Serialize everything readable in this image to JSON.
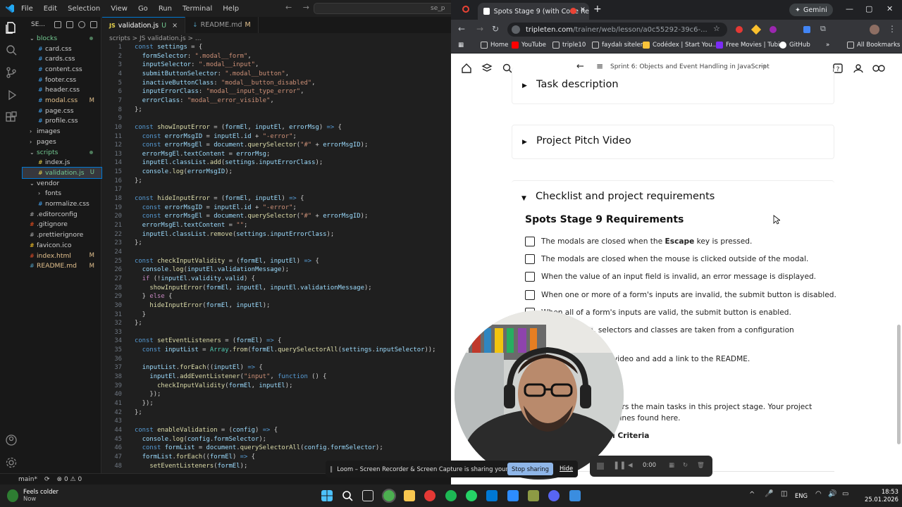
{
  "vscode": {
    "menu": [
      "File",
      "Edit",
      "Selection",
      "View",
      "Go",
      "Run",
      "Terminal",
      "Help"
    ],
    "search_text": "se_p",
    "explorer_title": "SE...",
    "tree": [
      {
        "label": "blocks",
        "kind": "folder-open",
        "indent": 0,
        "mark": "dot"
      },
      {
        "label": "card.css",
        "kind": "css",
        "indent": 1,
        "mark": ""
      },
      {
        "label": "cards.css",
        "kind": "css",
        "indent": 1,
        "mark": ""
      },
      {
        "label": "content.css",
        "kind": "css",
        "indent": 1,
        "mark": ""
      },
      {
        "label": "footer.css",
        "kind": "css",
        "indent": 1,
        "mark": ""
      },
      {
        "label": "header.css",
        "kind": "css",
        "indent": 1,
        "mark": ""
      },
      {
        "label": "modal.css",
        "kind": "css",
        "indent": 1,
        "mark": "M"
      },
      {
        "label": "page.css",
        "kind": "css",
        "indent": 1,
        "mark": ""
      },
      {
        "label": "profile.css",
        "kind": "css",
        "indent": 1,
        "mark": ""
      },
      {
        "label": "images",
        "kind": "folder",
        "indent": 0,
        "mark": ""
      },
      {
        "label": "pages",
        "kind": "folder",
        "indent": 0,
        "mark": ""
      },
      {
        "label": "scripts",
        "kind": "folder-open",
        "indent": 0,
        "mark": "dot"
      },
      {
        "label": "index.js",
        "kind": "js",
        "indent": 1,
        "mark": ""
      },
      {
        "label": "validation.js",
        "kind": "js",
        "indent": 1,
        "mark": "U",
        "selected": true
      },
      {
        "label": "vendor",
        "kind": "folder-open",
        "indent": 0,
        "mark": ""
      },
      {
        "label": "fonts",
        "kind": "folder",
        "indent": 1,
        "mark": ""
      },
      {
        "label": "normalize.css",
        "kind": "css",
        "indent": 1,
        "mark": ""
      },
      {
        "label": ".editorconfig",
        "kind": "cfg",
        "indent": 0,
        "mark": ""
      },
      {
        "label": ".gitignore",
        "kind": "git",
        "indent": 0,
        "mark": ""
      },
      {
        "label": ".prettierignore",
        "kind": "cfg",
        "indent": 0,
        "mark": ""
      },
      {
        "label": "favicon.ico",
        "kind": "ico",
        "indent": 0,
        "mark": ""
      },
      {
        "label": "index.html",
        "kind": "html",
        "indent": 0,
        "mark": "M"
      },
      {
        "label": "README.md",
        "kind": "md",
        "indent": 0,
        "mark": "M"
      }
    ],
    "tabs": [
      {
        "label": "validation.js",
        "badge": "U",
        "type": "JS",
        "active": true
      },
      {
        "label": "README.md",
        "badge": "M",
        "type": "MD",
        "active": false
      }
    ],
    "breadcrumb": "scripts > JS validation.js > ...",
    "code_lines": [
      "<k>const</k> <v>settings</v> = {",
      "  <v>formSelector</v>: <s>\".modal__form\"</s>,",
      "  <v>inputSelector</v>: <s>\".modal__input\"</s>,",
      "  <v>submitButtonSelector</v>: <s>\".modal__button\"</s>,",
      "  <v>inactiveButtonClass</v>: <s>\"modal__button_disabled\"</s>,",
      "  <v>inputErrorClass</v>: <s>\"modal__input_type_error\"</s>,",
      "  <v>errorClass</v>: <s>\"modal__error_visible\"</s>,",
      "};",
      "",
      "<k>const</k> <f>showInputError</f> = (<v>formEl</v>, <v>inputEl</v>, <v>errorMsg</v>) <k>=></k> {",
      "  <k>const</k> <v>errorMsgID</v> = <v>inputEl</v>.<v>id</v> + <s>\"-error\"</s>;",
      "  <k>const</k> <v>errorMsgEl</v> = <v>document</v>.<f>querySelector</f>(<s>\"#\"</s> + <v>errorMsgID</v>);",
      "  <v>errorMsgEl</v>.<v>textContent</v> = <v>errorMsg</v>;",
      "  <v>inputEl</v>.<v>classList</v>.<f>add</f>(<v>settings</v>.<v>inputErrorClass</v>);",
      "  <v>console</v>.<f>log</f>(<v>errorMsgID</v>);",
      "};",
      "",
      "<k>const</k> <f>hideInputError</f> = (<v>formEl</v>, <v>inputEl</v>) <k>=></k> {",
      "  <k>const</k> <v>errorMsgID</v> = <v>inputEl</v>.<v>id</v> + <s>\"-error\"</s>;",
      "  <k>const</k> <v>errorMsgEl</v> = <v>document</v>.<f>querySelector</f>(<s>\"#\"</s> + <v>errorMsgID</v>);",
      "  <v>errorMsgEl</v>.<v>textContent</v> = <s>\"\"</s>;",
      "  <v>inputEl</v>.<v>classList</v>.<f>remove</f>(<v>settings</v>.<v>inputErrorClass</v>);",
      "};",
      "",
      "<k>const</k> <f>checkInputValidity</f> = (<v>formEl</v>, <v>inputEl</v>) <k>=></k> {",
      "  <v>console</v>.<f>log</f>(<v>inputEl</v>.<v>validationMessage</v>);",
      "  <m>if</m> (!<v>inputEl</v>.<v>validity</v>.<v>valid</v>) {",
      "    <f>showInputError</f>(<v>formEl</v>, <v>inputEl</v>, <v>inputEl</v>.<v>validationMessage</v>);",
      "  } <m>else</m> {",
      "    <f>hideInputError</f>(<v>formEl</v>, <v>inputEl</v>);",
      "  }",
      "};",
      "",
      "<k>const</k> <f>setEventListeners</f> = (<v>formEl</v>) <k>=></k> {",
      "  <k>const</k> <v>inputList</v> = <c>Array</c>.<f>from</f>(<v>formEl</v>.<f>querySelectorAll</f>(<v>settings</v>.<v>inputSelector</v>));",
      "",
      "  <v>inputList</v>.<f>forEach</f>((<v>inputEl</v>) <k>=></k> {",
      "    <v>inputEl</v>.<f>addEventListener</f>(<s>\"input\"</s>, <k>function</k> () {",
      "      <f>checkInputValidity</f>(<v>formEl</v>, <v>inputEl</v>);",
      "    });",
      "  });",
      "};",
      "",
      "<k>const</k> <f>enableValidation</f> = (<v>config</v>) <k>=></k> {",
      "  <v>console</v>.<f>log</f>(<v>config</v>.<v>formSelector</v>);",
      "  <k>const</k> <v>formList</v> = <v>document</v>.<f>querySelectorAll</f>(<v>config</v>.<v>formSelector</v>);",
      "  <v>formList</v>.<f>forEach</f>((<v>formEl</v>) <k>=></k> {",
      "    <f>setEventListeners</f>(<v>formEl</v>);"
    ],
    "status": {
      "branch": "main*",
      "problems": "⊗ 0 ⚠ 0"
    }
  },
  "chrome": {
    "tab_title": "Spots Stage 9 (with Code Re",
    "gemini_label": "Gemini",
    "url_host": "tripleten.com",
    "url_path": "/trainer/web/lesson/a0c55292-39c6-...",
    "bookmarks": [
      "Home",
      "YouTube",
      "triple10",
      "faydalı siteler",
      "Codédex | Start You...",
      "Free Movies | Tubi",
      "GitHub"
    ],
    "all_bookmarks": "All Bookmarks",
    "page_breadcrumb": "Sprint 6: Objects and Event Handling in JavaScript",
    "sections": [
      "Task description",
      "Project Pitch Video",
      "Checklist and project requirements"
    ],
    "req_title": "Spots Stage 9 Requirements",
    "requirements": [
      {
        "pre": "The modals are closed when the ",
        "bold": "Escape",
        "post": " key is pressed."
      },
      {
        "pre": "The modals are closed when the mouse is clicked outside of the modal.",
        "bold": "",
        "post": ""
      },
      {
        "pre": "When the value of an input field is invalid, an error message is displayed.",
        "bold": "",
        "post": ""
      },
      {
        "pre": "When one or more of a form's inputs are invalid, the submit button is disabled.",
        "bold": "",
        "post": ""
      },
      {
        "pre": "When all of a form's inputs are valid, the submit button is enabled.",
        "bold": "",
        "post": ""
      }
    ],
    "partial_texts": {
      "line6_code": ".js",
      "line6": ", selectors and classes are taken from a configuration",
      "line7": "video and add a link to the README.",
      "para1": "ers the main tasks in this project stage. Your project",
      "para2": "elines found here.",
      "crit": "al Criteria"
    }
  },
  "loom": {
    "share_text": "Loom – Screen Recorder & Screen Capture is sharing your screen.",
    "stop_label": "Stop sharing",
    "hide_label": "Hide",
    "timer": "0:00"
  },
  "taskbar": {
    "weather_title": "Feels colder",
    "weather_sub": "Now",
    "lang": "ENG",
    "time": "18:53",
    "date": "25.01.2026"
  }
}
